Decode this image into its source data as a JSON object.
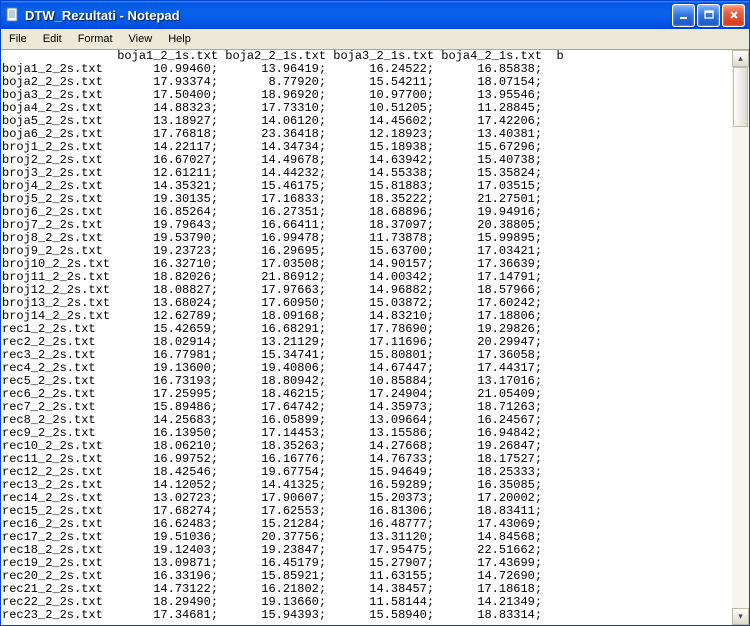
{
  "window": {
    "title": "DTW_Rezultati - Notepad"
  },
  "menu": [
    "File",
    "Edit",
    "Format",
    "View",
    "Help"
  ],
  "text": {
    "columns": [
      "boja1_2_1s.txt",
      "boja2_2_1s.txt",
      "boja3_2_1s.txt",
      "boja4_2_1s.txt"
    ],
    "trailing_partial": "b",
    "rows": [
      {
        "name": "boja1_2_2s.txt",
        "v": [
          "10.99460",
          "13.96419",
          "16.24522",
          "16.85838"
        ]
      },
      {
        "name": "boja2_2_2s.txt",
        "v": [
          "17.93374",
          "8.77920",
          "15.54211",
          "18.07154"
        ]
      },
      {
        "name": "boja3_2_2s.txt",
        "v": [
          "17.50400",
          "18.96920",
          "10.97700",
          "13.95546"
        ]
      },
      {
        "name": "boja4_2_2s.txt",
        "v": [
          "14.88323",
          "17.73310",
          "10.51205",
          "11.28845"
        ]
      },
      {
        "name": "boja5_2_2s.txt",
        "v": [
          "13.18927",
          "14.06120",
          "14.45602",
          "17.42206"
        ]
      },
      {
        "name": "boja6_2_2s.txt",
        "v": [
          "17.76818",
          "23.36418",
          "12.18923",
          "13.40381"
        ]
      },
      {
        "name": "broj1_2_2s.txt",
        "v": [
          "14.22117",
          "14.34734",
          "15.18938",
          "15.67296"
        ]
      },
      {
        "name": "broj2_2_2s.txt",
        "v": [
          "16.67027",
          "14.49678",
          "14.63942",
          "15.40738"
        ]
      },
      {
        "name": "broj3_2_2s.txt",
        "v": [
          "12.61211",
          "14.44232",
          "14.55338",
          "15.35824"
        ]
      },
      {
        "name": "broj4_2_2s.txt",
        "v": [
          "14.35321",
          "15.46175",
          "15.81883",
          "17.03515"
        ]
      },
      {
        "name": "broj5_2_2s.txt",
        "v": [
          "19.30135",
          "17.16833",
          "18.35222",
          "21.27501"
        ]
      },
      {
        "name": "broj6_2_2s.txt",
        "v": [
          "16.85264",
          "16.27351",
          "18.68896",
          "19.94916"
        ]
      },
      {
        "name": "broj7_2_2s.txt",
        "v": [
          "19.79643",
          "16.66411",
          "18.37097",
          "20.38805"
        ]
      },
      {
        "name": "broj8_2_2s.txt",
        "v": [
          "19.53790",
          "16.99478",
          "11.73878",
          "15.99895"
        ]
      },
      {
        "name": "broj9_2_2s.txt",
        "v": [
          "19.23723",
          "16.29695",
          "15.63700",
          "17.03421"
        ]
      },
      {
        "name": "broj10_2_2s.txt",
        "v": [
          "16.32710",
          "17.03508",
          "14.90157",
          "17.36639"
        ]
      },
      {
        "name": "broj11_2_2s.txt",
        "v": [
          "18.82026",
          "21.86912",
          "14.00342",
          "17.14791"
        ]
      },
      {
        "name": "broj12_2_2s.txt",
        "v": [
          "18.08827",
          "17.97663",
          "14.96882",
          "18.57966"
        ]
      },
      {
        "name": "broj13_2_2s.txt",
        "v": [
          "13.68024",
          "17.60950",
          "15.03872",
          "17.60242"
        ]
      },
      {
        "name": "broj14_2_2s.txt",
        "v": [
          "12.62789",
          "18.09168",
          "14.83210",
          "17.18806"
        ]
      },
      {
        "name": "rec1_2_2s.txt",
        "v": [
          "15.42659",
          "16.68291",
          "17.78690",
          "19.29826"
        ]
      },
      {
        "name": "rec2_2_2s.txt",
        "v": [
          "18.02914",
          "13.21129",
          "17.11696",
          "20.29947"
        ]
      },
      {
        "name": "rec3_2_2s.txt",
        "v": [
          "16.77981",
          "15.34741",
          "15.80801",
          "17.36058"
        ]
      },
      {
        "name": "rec4_2_2s.txt",
        "v": [
          "19.13600",
          "19.40806",
          "14.67447",
          "17.44317"
        ]
      },
      {
        "name": "rec5_2_2s.txt",
        "v": [
          "16.73193",
          "18.80942",
          "10.85884",
          "13.17016"
        ]
      },
      {
        "name": "rec6_2_2s.txt",
        "v": [
          "17.25995",
          "18.46215",
          "17.24904",
          "21.05409"
        ]
      },
      {
        "name": "rec7_2_2s.txt",
        "v": [
          "15.89486",
          "17.64742",
          "14.35973",
          "18.71263"
        ]
      },
      {
        "name": "rec8_2_2s.txt",
        "v": [
          "14.25683",
          "16.05899",
          "13.09664",
          "16.24567"
        ]
      },
      {
        "name": "rec9_2_2s.txt",
        "v": [
          "16.13950",
          "17.14453",
          "13.15586",
          "16.94842"
        ]
      },
      {
        "name": "rec10_2_2s.txt",
        "v": [
          "18.06210",
          "18.35263",
          "14.27668",
          "19.26847"
        ]
      },
      {
        "name": "rec11_2_2s.txt",
        "v": [
          "16.99752",
          "16.16776",
          "14.76733",
          "18.17527"
        ]
      },
      {
        "name": "rec12_2_2s.txt",
        "v": [
          "18.42546",
          "19.67754",
          "15.94649",
          "18.25333"
        ]
      },
      {
        "name": "rec13_2_2s.txt",
        "v": [
          "14.12052",
          "14.41325",
          "16.59289",
          "16.35085"
        ]
      },
      {
        "name": "rec14_2_2s.txt",
        "v": [
          "13.02723",
          "17.90607",
          "15.20373",
          "17.20002"
        ]
      },
      {
        "name": "rec15_2_2s.txt",
        "v": [
          "17.68274",
          "17.62553",
          "16.81306",
          "18.83411"
        ]
      },
      {
        "name": "rec16_2_2s.txt",
        "v": [
          "16.62483",
          "15.21284",
          "16.48777",
          "17.43069"
        ]
      },
      {
        "name": "rec17_2_2s.txt",
        "v": [
          "19.51036",
          "20.37756",
          "13.31120",
          "14.84568"
        ]
      },
      {
        "name": "rec18_2_2s.txt",
        "v": [
          "19.12403",
          "19.23847",
          "17.95475",
          "22.51662"
        ]
      },
      {
        "name": "rec19_2_2s.txt",
        "v": [
          "13.09871",
          "16.45179",
          "15.27907",
          "17.43699"
        ]
      },
      {
        "name": "rec20_2_2s.txt",
        "v": [
          "16.33196",
          "15.85921",
          "11.63155",
          "14.72690"
        ]
      },
      {
        "name": "rec21_2_2s.txt",
        "v": [
          "14.73122",
          "16.21802",
          "14.38457",
          "17.18618"
        ]
      },
      {
        "name": "rec22_2_2s.txt",
        "v": [
          "18.29490",
          "19.13660",
          "11.58144",
          "14.21349"
        ]
      },
      {
        "name": "rec23_2_2s.txt",
        "v": [
          "17.34681",
          "15.94393",
          "15.58940",
          "18.83314"
        ]
      }
    ]
  }
}
